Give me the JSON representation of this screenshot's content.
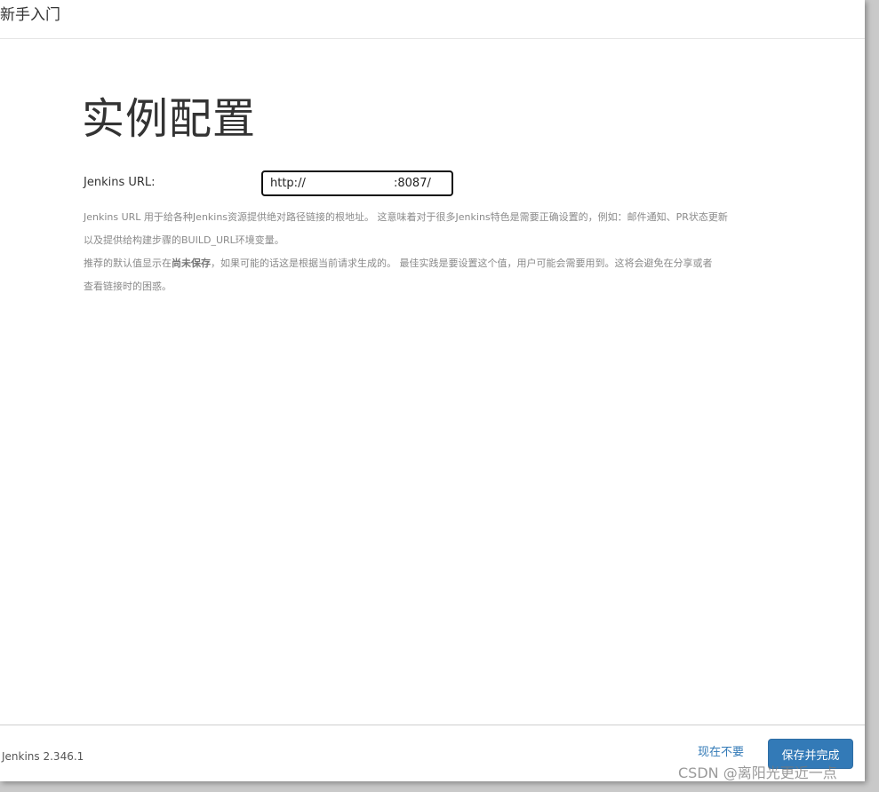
{
  "dialog": {
    "title": "新手入门"
  },
  "main": {
    "heading": "实例配置",
    "jenkins_url": {
      "label": "Jenkins URL:",
      "value": "http://                        :8087/"
    },
    "help": {
      "line1": "Jenkins URL 用于给各种Jenkins资源提供绝对路径链接的根地址。 这意味着对于很多Jenkins特色是需要正确设置的，例如：邮件通知、PR状态更新",
      "line2": "以及提供给构建步骤的BUILD_URL环境变量。",
      "line3_prefix": "推荐的默认值显示在",
      "line3_bold": "尚未保存",
      "line3_suffix": "，如果可能的话这是根据当前请求生成的。 最佳实践是要设置这个值，用户可能会需要用到。这将会避免在分享或者",
      "line4": "查看链接时的困惑。"
    }
  },
  "footer": {
    "version": "Jenkins 2.346.1",
    "skip_label": "现在不要",
    "save_label": "保存并完成"
  },
  "watermark": "CSDN @离阳光更近一点",
  "colors": {
    "primary": "#337ab7",
    "text": "#333333",
    "help_text": "#8a8a8a"
  }
}
